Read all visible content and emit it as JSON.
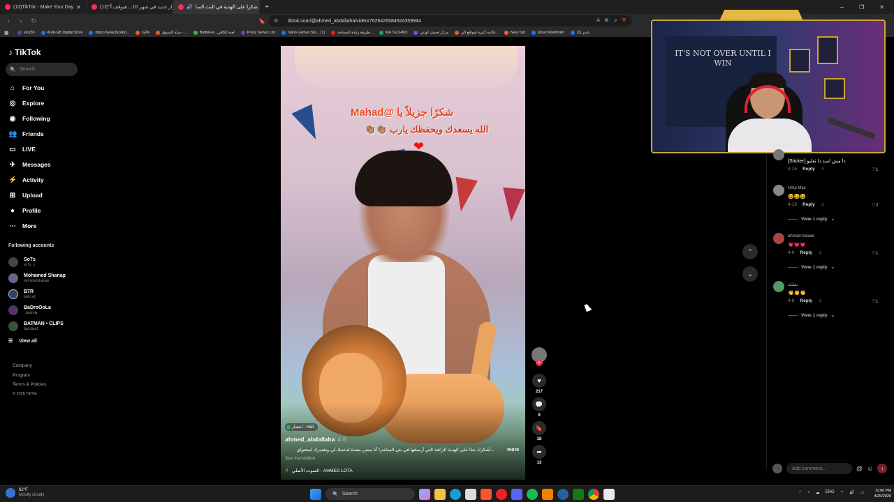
{
  "tabs": [
    {
      "label": "(13)TikTok - Make Your Day",
      "active": false
    },
    {
      "label": "(12)\"قرار جديد في شهر 10... هيوقف أ...",
      "active": false
    },
    {
      "label": "شكرا على الهدية في البث السا...",
      "active": true
    }
  ],
  "url": "tiktok.com/@ahmed_abdallaha/video/7626426584924359944",
  "bookmarks": [
    "alo230",
    "Arab-GB Digital Store",
    "https://www.facebo...",
    "G2A",
    "سلة التسوق - ...",
    "BattleFie...لعبة الكافي",
    "Proxy Server List",
    "Nano Games Sto... (1)",
    "طريقة زيادة المساحة...",
    "MA TECHNO",
    "مركز تحميل كونتي",
    "قائمة كتبرة لمواقع الن...",
    "New Tab",
    "Ωmar Moёhmёd",
    "(1) ياسر"
  ],
  "sidebar": {
    "logo": "TikTok",
    "search_placeholder": "Search",
    "menu": [
      {
        "label": "For You",
        "icon": "home-icon"
      },
      {
        "label": "Explore",
        "icon": "compass-icon"
      },
      {
        "label": "Following",
        "icon": "following-icon"
      },
      {
        "label": "Friends",
        "icon": "friends-icon"
      },
      {
        "label": "LIVE",
        "icon": "live-icon"
      },
      {
        "label": "Messages",
        "icon": "messages-icon"
      },
      {
        "label": "Activity",
        "icon": "activity-icon"
      },
      {
        "label": "Upload",
        "icon": "upload-icon"
      },
      {
        "label": "Profile",
        "icon": "profile-icon"
      },
      {
        "label": "More",
        "icon": "more-icon"
      }
    ],
    "following_title": "Following accounts",
    "following": [
      {
        "name": "So7s",
        "handle": "so7s_s"
      },
      {
        "name": "Mohamed Shanap",
        "handle": "mohmedshanap"
      },
      {
        "name": "B7R",
        "handle": "bahr.xd"
      },
      {
        "name": "BaDroOoLa",
        "handle": "_badrola"
      },
      {
        "name": "BATMAN • CLIPS",
        "handle": "bat.clips1"
      }
    ],
    "view_all": "View all",
    "footer": [
      "Company",
      "Program",
      "Terms & Policies",
      "© 2026 TikTok"
    ]
  },
  "video": {
    "overlay_line1": "شكرًا جزيلاً يا @Mahad",
    "overlay_line2": "الله يسعدك ويحفظك يارب 👏🏽👏🏽",
    "tag": "انتشار · Hall",
    "username": "ahmed_abdallaha",
    "date": "4-8",
    "description": "...أشكرك جدًا على الهدية الرائعة التي أرسلتها في بثي المباشر! أنا ممتن بشدة لدعمك لي وتقديرك لمحتواي",
    "more": "more",
    "see_translation": "See translation",
    "music": "الصوت الأصلي - AHMED LOTA",
    "likes": "217",
    "comments": "9",
    "saves": "18",
    "shares": "13"
  },
  "webcam": {
    "poster_text": "IT'S NOT OVER UNTIL I WIN"
  },
  "comments": [
    {
      "name": "",
      "text": "[Sticker] دا مش اسد دا ثعلبو",
      "date": "4-15",
      "reply": "Reply",
      "likes": "1",
      "view_replies": ""
    },
    {
      "name": "Ump Max",
      "text": "😆😆😆",
      "date": "4-13",
      "reply": "Reply",
      "likes": "2",
      "view_replies": "View 1 reply"
    },
    {
      "name": "ahmad-halawi",
      "text": "💗💗💗",
      "date": "4-9",
      "reply": "Reply",
      "likes": "1",
      "view_replies": "View 1 reply"
    },
    {
      "name": "شليله",
      "text": "👏👏👏",
      "date": "4-8",
      "reply": "Reply",
      "likes": "1",
      "view_replies": "View 1 reply"
    }
  ],
  "add_comment_placeholder": "Add comment...",
  "taskbar": {
    "temp": "62°F",
    "weather": "Mostly cloudy",
    "search": "Search",
    "lang": "ENG",
    "time": "11:06 PM",
    "date": "4/25/2026"
  }
}
